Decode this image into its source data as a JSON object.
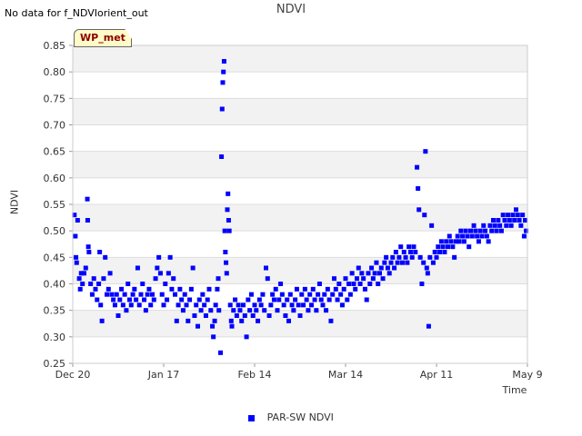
{
  "status_text": "No data for f_NDVIorient_out",
  "badge_label": "WP_met",
  "chart_data": {
    "type": "scatter",
    "title": "NDVI",
    "xlabel": "Time",
    "ylabel": "NDVI",
    "ylim": [
      0.25,
      0.85
    ],
    "y_ticks": [
      "0.25",
      "0.30",
      "0.35",
      "0.40",
      "0.45",
      "0.50",
      "0.55",
      "0.60",
      "0.65",
      "0.70",
      "0.75",
      "0.80",
      "0.85"
    ],
    "x_range_days": [
      0,
      140
    ],
    "x_ticks": [
      {
        "day": 0,
        "label": "Dec 20"
      },
      {
        "day": 28,
        "label": "Jan 17"
      },
      {
        "day": 56,
        "label": "Feb 14"
      },
      {
        "day": 84,
        "label": "Mar 14"
      },
      {
        "day": 112,
        "label": "Apr 11"
      },
      {
        "day": 140,
        "label": "May 9"
      }
    ],
    "grid": true,
    "legend_position": "bottom-center",
    "series": [
      {
        "name": "PAR-SW NDVI",
        "color": "#0000ff",
        "points": [
          [
            0.5,
            0.53
          ],
          [
            0.8,
            0.49
          ],
          [
            1.0,
            0.45
          ],
          [
            1.2,
            0.44
          ],
          [
            1.5,
            0.52
          ],
          [
            2.0,
            0.41
          ],
          [
            2.3,
            0.39
          ],
          [
            2.6,
            0.42
          ],
          [
            3.0,
            0.4
          ],
          [
            3.5,
            0.42
          ],
          [
            4.0,
            0.43
          ],
          [
            4.5,
            0.56
          ],
          [
            4.6,
            0.52
          ],
          [
            4.8,
            0.47
          ],
          [
            5.0,
            0.46
          ],
          [
            5.5,
            0.4
          ],
          [
            6.0,
            0.38
          ],
          [
            6.5,
            0.41
          ],
          [
            7.0,
            0.39
          ],
          [
            7.5,
            0.37
          ],
          [
            8.0,
            0.4
          ],
          [
            8.3,
            0.46
          ],
          [
            8.6,
            0.36
          ],
          [
            9.0,
            0.33
          ],
          [
            9.5,
            0.41
          ],
          [
            10.0,
            0.45
          ],
          [
            10.5,
            0.38
          ],
          [
            11.0,
            0.39
          ],
          [
            11.5,
            0.42
          ],
          [
            12.0,
            0.38
          ],
          [
            12.5,
            0.37
          ],
          [
            13.0,
            0.36
          ],
          [
            13.5,
            0.38
          ],
          [
            14.0,
            0.34
          ],
          [
            14.5,
            0.37
          ],
          [
            15.0,
            0.39
          ],
          [
            15.5,
            0.36
          ],
          [
            16.0,
            0.38
          ],
          [
            16.5,
            0.35
          ],
          [
            17.0,
            0.4
          ],
          [
            17.5,
            0.37
          ],
          [
            18.0,
            0.36
          ],
          [
            18.5,
            0.38
          ],
          [
            19.0,
            0.39
          ],
          [
            19.5,
            0.37
          ],
          [
            20.0,
            0.43
          ],
          [
            20.5,
            0.36
          ],
          [
            21.0,
            0.38
          ],
          [
            21.5,
            0.4
          ],
          [
            22.0,
            0.37
          ],
          [
            22.5,
            0.35
          ],
          [
            23.0,
            0.38
          ],
          [
            23.5,
            0.39
          ],
          [
            24.0,
            0.36
          ],
          [
            24.5,
            0.38
          ],
          [
            25.0,
            0.37
          ],
          [
            25.5,
            0.41
          ],
          [
            26.0,
            0.43
          ],
          [
            26.5,
            0.45
          ],
          [
            27.0,
            0.42
          ],
          [
            27.5,
            0.38
          ],
          [
            28.0,
            0.36
          ],
          [
            28.5,
            0.4
          ],
          [
            29.0,
            0.37
          ],
          [
            29.5,
            0.42
          ],
          [
            30.0,
            0.45
          ],
          [
            30.5,
            0.39
          ],
          [
            31.0,
            0.41
          ],
          [
            31.5,
            0.38
          ],
          [
            32.0,
            0.33
          ],
          [
            32.5,
            0.36
          ],
          [
            33.0,
            0.39
          ],
          [
            33.5,
            0.37
          ],
          [
            34.0,
            0.35
          ],
          [
            34.5,
            0.38
          ],
          [
            35.0,
            0.36
          ],
          [
            35.5,
            0.33
          ],
          [
            36.0,
            0.37
          ],
          [
            36.5,
            0.39
          ],
          [
            37.0,
            0.43
          ],
          [
            37.5,
            0.34
          ],
          [
            38.0,
            0.36
          ],
          [
            38.5,
            0.32
          ],
          [
            39.0,
            0.37
          ],
          [
            39.5,
            0.35
          ],
          [
            40.0,
            0.38
          ],
          [
            40.5,
            0.36
          ],
          [
            41.0,
            0.34
          ],
          [
            41.5,
            0.37
          ],
          [
            42.0,
            0.39
          ],
          [
            42.5,
            0.35
          ],
          [
            43.0,
            0.32
          ],
          [
            43.3,
            0.3
          ],
          [
            43.7,
            0.33
          ],
          [
            44.0,
            0.36
          ],
          [
            44.5,
            0.39
          ],
          [
            44.8,
            0.41
          ],
          [
            45.0,
            0.35
          ],
          [
            45.5,
            0.27
          ],
          [
            45.8,
            0.64
          ],
          [
            46.0,
            0.73
          ],
          [
            46.2,
            0.78
          ],
          [
            46.4,
            0.8
          ],
          [
            46.6,
            0.82
          ],
          [
            46.8,
            0.5
          ],
          [
            47.0,
            0.46
          ],
          [
            47.2,
            0.44
          ],
          [
            47.4,
            0.42
          ],
          [
            47.6,
            0.54
          ],
          [
            47.8,
            0.57
          ],
          [
            48.0,
            0.52
          ],
          [
            48.2,
            0.5
          ],
          [
            48.5,
            0.36
          ],
          [
            48.8,
            0.33
          ],
          [
            49.0,
            0.32
          ],
          [
            49.5,
            0.35
          ],
          [
            50.0,
            0.37
          ],
          [
            50.5,
            0.34
          ],
          [
            51.0,
            0.36
          ],
          [
            51.5,
            0.35
          ],
          [
            52.0,
            0.33
          ],
          [
            52.5,
            0.36
          ],
          [
            53.0,
            0.34
          ],
          [
            53.5,
            0.3
          ],
          [
            54.0,
            0.37
          ],
          [
            54.5,
            0.35
          ],
          [
            55.0,
            0.38
          ],
          [
            55.5,
            0.34
          ],
          [
            56.0,
            0.36
          ],
          [
            56.5,
            0.35
          ],
          [
            57.0,
            0.33
          ],
          [
            57.5,
            0.37
          ],
          [
            58.0,
            0.36
          ],
          [
            58.5,
            0.38
          ],
          [
            59.0,
            0.35
          ],
          [
            59.5,
            0.43
          ],
          [
            60.0,
            0.41
          ],
          [
            60.5,
            0.34
          ],
          [
            61.0,
            0.36
          ],
          [
            61.5,
            0.38
          ],
          [
            62.0,
            0.37
          ],
          [
            62.5,
            0.39
          ],
          [
            63.0,
            0.35
          ],
          [
            63.5,
            0.37
          ],
          [
            64.0,
            0.4
          ],
          [
            64.5,
            0.38
          ],
          [
            65.0,
            0.36
          ],
          [
            65.5,
            0.34
          ],
          [
            66.0,
            0.37
          ],
          [
            66.5,
            0.33
          ],
          [
            67.0,
            0.38
          ],
          [
            67.5,
            0.36
          ],
          [
            68.0,
            0.35
          ],
          [
            68.5,
            0.37
          ],
          [
            69.0,
            0.39
          ],
          [
            69.5,
            0.36
          ],
          [
            70.0,
            0.34
          ],
          [
            70.5,
            0.38
          ],
          [
            71.0,
            0.36
          ],
          [
            71.5,
            0.39
          ],
          [
            72.0,
            0.37
          ],
          [
            72.5,
            0.35
          ],
          [
            73.0,
            0.38
          ],
          [
            73.5,
            0.36
          ],
          [
            74.0,
            0.39
          ],
          [
            74.5,
            0.37
          ],
          [
            75.0,
            0.35
          ],
          [
            75.5,
            0.38
          ],
          [
            76.0,
            0.4
          ],
          [
            76.5,
            0.37
          ],
          [
            77.0,
            0.36
          ],
          [
            77.5,
            0.38
          ],
          [
            78.0,
            0.35
          ],
          [
            78.5,
            0.39
          ],
          [
            79.0,
            0.37
          ],
          [
            79.5,
            0.33
          ],
          [
            80.0,
            0.38
          ],
          [
            80.5,
            0.41
          ],
          [
            81.0,
            0.39
          ],
          [
            81.5,
            0.37
          ],
          [
            82.0,
            0.4
          ],
          [
            82.5,
            0.38
          ],
          [
            83.0,
            0.36
          ],
          [
            83.5,
            0.39
          ],
          [
            84.0,
            0.41
          ],
          [
            84.5,
            0.37
          ],
          [
            85.0,
            0.4
          ],
          [
            85.5,
            0.38
          ],
          [
            86.0,
            0.42
          ],
          [
            86.5,
            0.4
          ],
          [
            87.0,
            0.39
          ],
          [
            87.5,
            0.41
          ],
          [
            88.0,
            0.43
          ],
          [
            88.5,
            0.4
          ],
          [
            89.0,
            0.42
          ],
          [
            89.5,
            0.41
          ],
          [
            90.0,
            0.39
          ],
          [
            90.5,
            0.37
          ],
          [
            91.0,
            0.42
          ],
          [
            91.5,
            0.4
          ],
          [
            92.0,
            0.43
          ],
          [
            92.5,
            0.41
          ],
          [
            93.0,
            0.42
          ],
          [
            93.5,
            0.44
          ],
          [
            94.0,
            0.4
          ],
          [
            94.5,
            0.42
          ],
          [
            95.0,
            0.43
          ],
          [
            95.5,
            0.41
          ],
          [
            96.0,
            0.44
          ],
          [
            96.5,
            0.45
          ],
          [
            97.0,
            0.43
          ],
          [
            97.5,
            0.42
          ],
          [
            98.0,
            0.44
          ],
          [
            98.5,
            0.45
          ],
          [
            99.0,
            0.43
          ],
          [
            99.5,
            0.46
          ],
          [
            100.0,
            0.44
          ],
          [
            100.5,
            0.45
          ],
          [
            101.0,
            0.47
          ],
          [
            101.5,
            0.44
          ],
          [
            102.0,
            0.46
          ],
          [
            102.5,
            0.45
          ],
          [
            103.0,
            0.44
          ],
          [
            103.5,
            0.47
          ],
          [
            104.0,
            0.46
          ],
          [
            104.5,
            0.45
          ],
          [
            105.0,
            0.47
          ],
          [
            105.5,
            0.46
          ],
          [
            106.0,
            0.62
          ],
          [
            106.3,
            0.58
          ],
          [
            106.6,
            0.54
          ],
          [
            107.0,
            0.45
          ],
          [
            107.5,
            0.4
          ],
          [
            108.0,
            0.44
          ],
          [
            108.3,
            0.53
          ],
          [
            108.6,
            0.65
          ],
          [
            109.0,
            0.43
          ],
          [
            109.3,
            0.42
          ],
          [
            109.6,
            0.32
          ],
          [
            110.0,
            0.45
          ],
          [
            110.5,
            0.51
          ],
          [
            111.0,
            0.44
          ],
          [
            111.5,
            0.46
          ],
          [
            112.0,
            0.45
          ],
          [
            112.5,
            0.47
          ],
          [
            113.0,
            0.46
          ],
          [
            113.5,
            0.48
          ],
          [
            114.0,
            0.47
          ],
          [
            114.5,
            0.46
          ],
          [
            115.0,
            0.48
          ],
          [
            115.5,
            0.47
          ],
          [
            116.0,
            0.49
          ],
          [
            116.5,
            0.48
          ],
          [
            117.0,
            0.47
          ],
          [
            117.5,
            0.45
          ],
          [
            118.0,
            0.48
          ],
          [
            118.5,
            0.49
          ],
          [
            119.0,
            0.48
          ],
          [
            119.5,
            0.5
          ],
          [
            120.0,
            0.49
          ],
          [
            120.5,
            0.48
          ],
          [
            121.0,
            0.5
          ],
          [
            121.5,
            0.49
          ],
          [
            122.0,
            0.47
          ],
          [
            122.5,
            0.5
          ],
          [
            123.0,
            0.49
          ],
          [
            123.5,
            0.51
          ],
          [
            124.0,
            0.5
          ],
          [
            124.5,
            0.49
          ],
          [
            125.0,
            0.48
          ],
          [
            125.5,
            0.5
          ],
          [
            126.0,
            0.49
          ],
          [
            126.5,
            0.51
          ],
          [
            127.0,
            0.5
          ],
          [
            127.5,
            0.49
          ],
          [
            128.0,
            0.48
          ],
          [
            128.5,
            0.51
          ],
          [
            129.0,
            0.5
          ],
          [
            129.5,
            0.52
          ],
          [
            130.0,
            0.51
          ],
          [
            130.5,
            0.5
          ],
          [
            131.0,
            0.52
          ],
          [
            131.5,
            0.51
          ],
          [
            132.0,
            0.5
          ],
          [
            132.5,
            0.53
          ],
          [
            133.0,
            0.52
          ],
          [
            133.5,
            0.51
          ],
          [
            134.0,
            0.53
          ],
          [
            134.5,
            0.52
          ],
          [
            135.0,
            0.51
          ],
          [
            135.5,
            0.53
          ],
          [
            136.0,
            0.52
          ],
          [
            136.5,
            0.54
          ],
          [
            137.0,
            0.53
          ],
          [
            137.5,
            0.52
          ],
          [
            138.0,
            0.51
          ],
          [
            138.5,
            0.53
          ],
          [
            139.0,
            0.49
          ],
          [
            139.3,
            0.52
          ],
          [
            139.6,
            0.5
          ]
        ]
      }
    ]
  }
}
